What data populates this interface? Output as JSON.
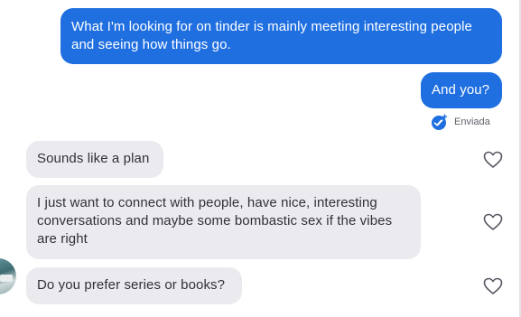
{
  "messages": [
    {
      "direction": "outgoing",
      "text": "What I'm looking for on tinder is mainly meeting interesting people and seeing how things go."
    },
    {
      "direction": "outgoing",
      "text": "And you?"
    },
    {
      "direction": "incoming",
      "text": "Sounds like a plan"
    },
    {
      "direction": "incoming",
      "text": "I just want to connect with people, have nice, interesting conversations and maybe some bombastic sex if the vibes are right"
    },
    {
      "direction": "incoming",
      "text": "Do you prefer series or books?"
    }
  ],
  "status": {
    "label": "Enviada",
    "icon": "sent-check-icon"
  },
  "icons": {
    "like": "heart-outline-icon",
    "avatar": "profile-avatar"
  },
  "colors": {
    "outgoing_bubble": "#1f6fe0",
    "incoming_bubble": "#ebebef",
    "sent_badge": "#1f6fe0"
  }
}
